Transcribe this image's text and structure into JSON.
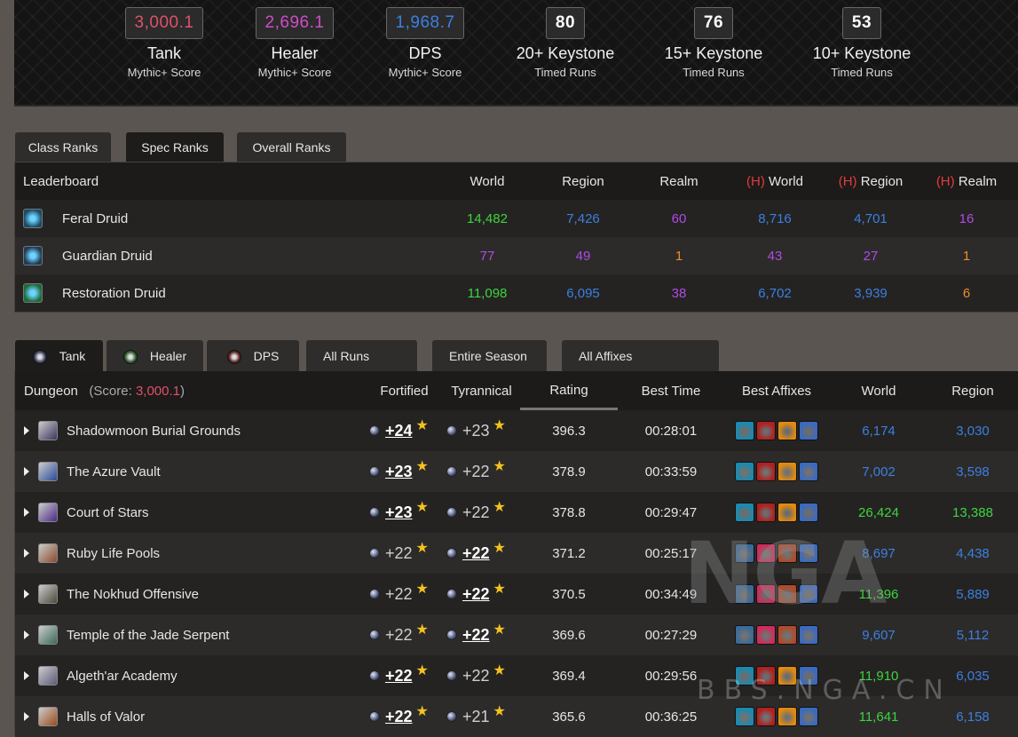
{
  "scores": [
    {
      "value": "3,000.1",
      "name": "Tank",
      "sub": "Mythic+ Score",
      "color": "#e0506a"
    },
    {
      "value": "2,696.1",
      "name": "Healer",
      "sub": "Mythic+ Score",
      "color": "#d04cc8"
    },
    {
      "value": "1,968.7",
      "name": "DPS",
      "sub": "Mythic+ Score",
      "color": "#3d7fe0"
    },
    {
      "value": "80",
      "name": "20+ Keystone",
      "sub": "Timed Runs",
      "color": "#ffffff"
    },
    {
      "value": "76",
      "name": "15+ Keystone",
      "sub": "Timed Runs",
      "color": "#ffffff"
    },
    {
      "value": "53",
      "name": "10+ Keystone",
      "sub": "Timed Runs",
      "color": "#ffffff"
    }
  ],
  "rank_tabs": [
    "Class Ranks",
    "Spec Ranks",
    "Overall Ranks"
  ],
  "rank_active_tab": "Spec Ranks",
  "rank_headers": {
    "leaderboard": "Leaderboard",
    "world": "World",
    "region": "Region",
    "realm": "Realm",
    "h_mark": "(H)"
  },
  "specs": [
    {
      "name": "Feral Druid",
      "icon": "feral-druid-icon",
      "world": "14,482",
      "region": "7,426",
      "realm": "60",
      "h_world": "8,716",
      "h_region": "4,701",
      "h_realm": "16",
      "colors": [
        "green",
        "blue",
        "purple",
        "blue",
        "blue",
        "purple"
      ]
    },
    {
      "name": "Guardian Druid",
      "icon": "guardian-druid-icon",
      "world": "77",
      "region": "49",
      "realm": "1",
      "h_world": "43",
      "h_region": "27",
      "h_realm": "1",
      "colors": [
        "purple",
        "purple",
        "orange",
        "purple",
        "purple",
        "orange"
      ]
    },
    {
      "name": "Restoration Druid",
      "icon": "restoration-druid-icon",
      "world": "11,098",
      "region": "6,095",
      "realm": "38",
      "h_world": "6,702",
      "h_region": "3,939",
      "h_realm": "6",
      "colors": [
        "green",
        "blue",
        "purple",
        "blue",
        "blue",
        "orange"
      ]
    }
  ],
  "role_tabs": [
    "Tank",
    "Healer",
    "DPS"
  ],
  "filters": [
    "All Runs",
    "Entire Season",
    "All Affixes"
  ],
  "runs_headers": {
    "dungeon": "Dungeon",
    "score_label": "(Score:",
    "score_value": "3,000.1",
    "score_close": ")",
    "fortified": "Fortified",
    "tyrannical": "Tyrannical",
    "rating": "Rating",
    "best_time": "Best Time",
    "best_affixes": "Best Affixes",
    "world": "World",
    "region": "Region"
  },
  "dungeons": [
    {
      "name": "Shadowmoon Burial Grounds",
      "fort": "+24",
      "tyr": "+23",
      "best": "fort",
      "rating": "396.3",
      "time": "00:28:01",
      "world": "6,174",
      "region": "3,030",
      "wc": "blue",
      "rc": "blue",
      "affix": "set1"
    },
    {
      "name": "The Azure Vault",
      "fort": "+23",
      "tyr": "+22",
      "best": "fort",
      "rating": "378.9",
      "time": "00:33:59",
      "world": "7,002",
      "region": "3,598",
      "wc": "blue",
      "rc": "blue",
      "affix": "set1"
    },
    {
      "name": "Court of Stars",
      "fort": "+23",
      "tyr": "+22",
      "best": "fort",
      "rating": "378.8",
      "time": "00:29:47",
      "world": "26,424",
      "region": "13,388",
      "wc": "green",
      "rc": "green",
      "affix": "set1"
    },
    {
      "name": "Ruby Life Pools",
      "fort": "+22",
      "tyr": "+22",
      "best": "tyr",
      "rating": "371.2",
      "time": "00:25:17",
      "world": "8,697",
      "region": "4,438",
      "wc": "blue",
      "rc": "blue",
      "affix": "set2"
    },
    {
      "name": "The Nokhud Offensive",
      "fort": "+22",
      "tyr": "+22",
      "best": "tyr",
      "rating": "370.5",
      "time": "00:34:49",
      "world": "11,396",
      "region": "5,889",
      "wc": "green",
      "rc": "blue",
      "affix": "set2"
    },
    {
      "name": "Temple of the Jade Serpent",
      "fort": "+22",
      "tyr": "+22",
      "best": "tyr",
      "rating": "369.6",
      "time": "00:27:29",
      "world": "9,607",
      "region": "5,112",
      "wc": "blue",
      "rc": "blue",
      "affix": "set2"
    },
    {
      "name": "Algeth'ar Academy",
      "fort": "+22",
      "tyr": "+22",
      "best": "fort",
      "rating": "369.4",
      "time": "00:29:56",
      "world": "11,910",
      "region": "6,035",
      "wc": "green",
      "rc": "blue",
      "affix": "set1"
    },
    {
      "name": "Halls of Valor",
      "fort": "+22",
      "tyr": "+21",
      "best": "fort",
      "rating": "365.6",
      "time": "00:36:25",
      "world": "11,641",
      "region": "6,158",
      "wc": "green",
      "rc": "blue",
      "affix": "set1"
    }
  ],
  "watermark": "NGA",
  "watermark_url": "BBS.NGA.CN"
}
